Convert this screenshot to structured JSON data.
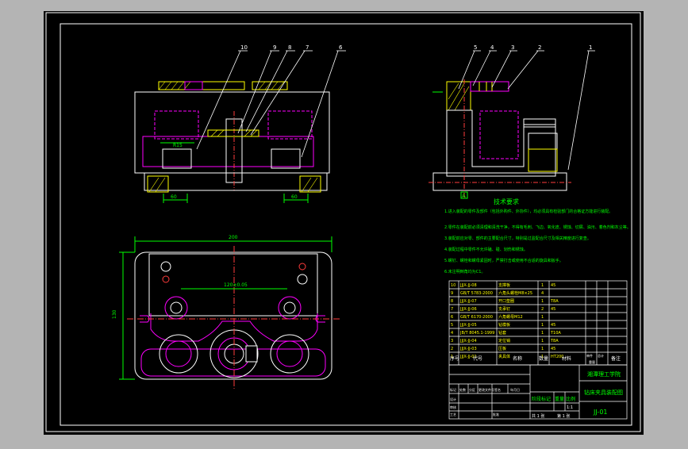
{
  "colors": {
    "frame_bg": "#b4b4b4",
    "canvas": "#000000",
    "outline": "#ffffff",
    "part": "#ff00ff",
    "dim": "#00ff00",
    "hatch": "#ffff00",
    "center": "#ff3b3b",
    "leader": "#ffffff"
  },
  "balloons": {
    "front": [
      "10",
      "9",
      "8",
      "7",
      "6"
    ],
    "side": [
      "5",
      "4",
      "3",
      "2",
      "1"
    ]
  },
  "view_label": "A",
  "tech_title": "技术要求",
  "tech_notes": [
    "1.进入装配的零件及部件（包括外购件、外协件），均必须具有检验部门的合格证方能进行装配。",
    "2.零件在装配前必须清理和清洗干净，不得有毛刺、飞边、氧化皮、锈蚀、切屑、油污、着色剂和灰尘等。",
    "3.装配前应对零、部件的主要配合尺寸，特别是过盈配合尺寸及相关精度进行复查。",
    "4.装配过程中零件不允许磕、碰、划伤和锈蚀。",
    "5.螺钉、螺栓和螺母紧固时，严禁打击或使用不合适的旋具和扳手。",
    "6.未注明倒角均为C1。"
  ],
  "bom_rows": [
    {
      "no": "10",
      "code": "JJJX-JJ-08",
      "name": "支撑板",
      "qty": "1",
      "mat": "45"
    },
    {
      "no": "9",
      "code": "GB/T 5783-2000",
      "name": "六角头螺栓M8×25",
      "qty": "4",
      "mat": ""
    },
    {
      "no": "8",
      "code": "JJJX-JJ-07",
      "name": "开口垫圈",
      "qty": "1",
      "mat": "T8A"
    },
    {
      "no": "7",
      "code": "JJJX-JJ-06",
      "name": "支承钉",
      "qty": "2",
      "mat": "45"
    },
    {
      "no": "6",
      "code": "GB/T 6170-2000",
      "name": "六角螺母M12",
      "qty": "1",
      "mat": ""
    },
    {
      "no": "5",
      "code": "JJJX-JJ-05",
      "name": "钻模板",
      "qty": "1",
      "mat": "45"
    },
    {
      "no": "4",
      "code": "JB/T 8045.1-1999",
      "name": "钻套",
      "qty": "1",
      "mat": "T10A"
    },
    {
      "no": "3",
      "code": "JJJX-JJ-04",
      "name": "定位销",
      "qty": "1",
      "mat": "T8A"
    },
    {
      "no": "2",
      "code": "JJJX-JJ-03",
      "name": "压板",
      "qty": "1",
      "mat": "45"
    },
    {
      "no": "1",
      "code": "JJJX-JJ-01",
      "name": "夹具体",
      "qty": "1",
      "mat": "HT200"
    }
  ],
  "bom_header": {
    "no": "序号",
    "code": "代号",
    "name": "名称",
    "qty": "数量",
    "mat": "材料",
    "single": "单件",
    "total": "总计",
    "weight": "重量",
    "remark": "备注"
  },
  "title_block": {
    "school": "湘潭理工学院",
    "drawing_name": "钻床夹具装配图",
    "drawing_no": "JJ-01",
    "stage": "阶段标记",
    "weight": "重量",
    "scale": "比例",
    "scale_value": "1:1",
    "sheet_total": "共 1 张",
    "sheet_no": "第 1 张",
    "rev_headers": [
      "标记",
      "处数",
      "分区",
      "更改文件号",
      "签名",
      "年月日"
    ],
    "role_rows": [
      "设计",
      "审核",
      "工艺",
      "批准"
    ]
  },
  "dims": {
    "top_a": "R15",
    "top_b": "60",
    "top_c": "60",
    "plan_width": "200",
    "plan_height": "130",
    "plan_inner": "120±0.05"
  }
}
